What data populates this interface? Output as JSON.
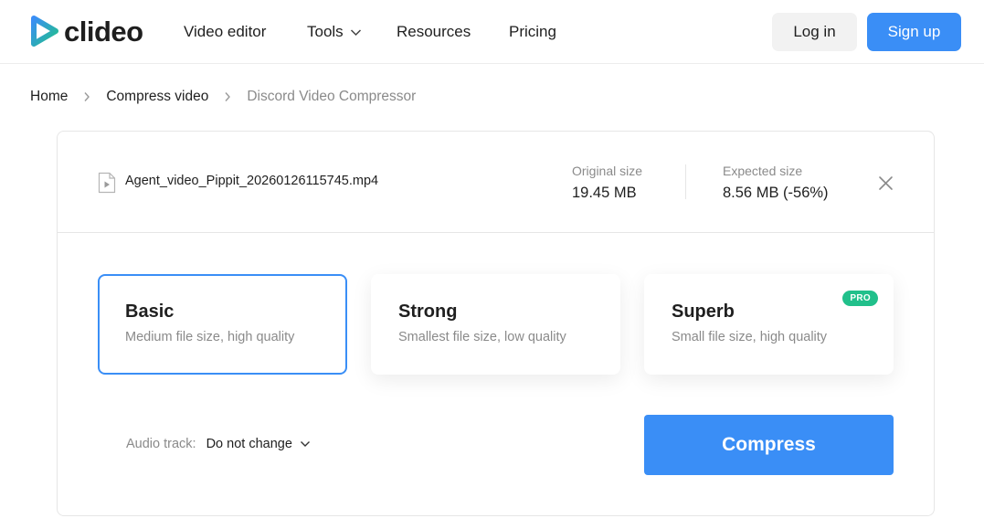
{
  "header": {
    "logo_text": "clideo",
    "nav": {
      "video_editor": "Video editor",
      "tools": "Tools",
      "resources": "Resources",
      "pricing": "Pricing"
    },
    "login_label": "Log in",
    "signup_label": "Sign up"
  },
  "breadcrumb": {
    "items": [
      "Home",
      "Compress video",
      "Discord Video Compressor"
    ]
  },
  "file": {
    "name": "Agent_video_Pippit_20260126115745.mp4",
    "original_size_label": "Original size",
    "original_size": "19.45 MB",
    "expected_size_label": "Expected size",
    "expected_size": "8.56 MB (-56%)"
  },
  "options": [
    {
      "title": "Basic",
      "description": "Medium file size, high quality",
      "selected": true
    },
    {
      "title": "Strong",
      "description": "Smallest file size, low quality",
      "selected": false
    },
    {
      "title": "Superb",
      "description": "Small file size, high quality",
      "selected": false,
      "badge": "PRO"
    }
  ],
  "audio": {
    "label": "Audio track:",
    "value": "Do not change"
  },
  "compress_label": "Compress",
  "colors": {
    "accent": "#3a8ef6",
    "pro_badge": "#21c08b",
    "muted_text": "#8a8a8a"
  },
  "icons": [
    "clideo-logo-icon",
    "chevron-down-icon",
    "chevron-right-icon",
    "file-video-icon",
    "close-icon"
  ]
}
